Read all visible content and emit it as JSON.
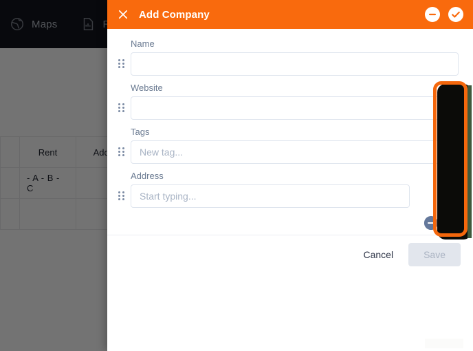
{
  "background": {
    "navbar": {
      "items": [
        {
          "label": "Maps",
          "icon": "globe-icon"
        },
        {
          "label": "Rep",
          "icon": "report-icon"
        }
      ]
    },
    "table": {
      "columns": [
        "",
        "Rent",
        "Address",
        ""
      ],
      "rows": [
        [
          "",
          "- A - B - C",
          "",
          ""
        ],
        [
          "",
          "",
          "",
          ""
        ]
      ]
    }
  },
  "dialog": {
    "title": "Add Company",
    "close_icon": "close-icon",
    "header_actions": [
      {
        "name": "collapse-all-button",
        "icon": "minus-circle-icon"
      },
      {
        "name": "confirm-button",
        "icon": "check-circle-icon"
      }
    ],
    "fields": [
      {
        "label": "Name",
        "placeholder": "",
        "value": "",
        "handle": "drag-handle-icon",
        "action": "none"
      },
      {
        "label": "Website",
        "placeholder": "",
        "value": "",
        "handle": "drag-handle-icon",
        "action": "remove"
      },
      {
        "label": "Tags",
        "placeholder": "New tag...",
        "value": "",
        "handle": "drag-handle-icon",
        "action": "remove"
      },
      {
        "label": "Address",
        "placeholder": "Start typing...",
        "value": "",
        "handle": "drag-handle-icon",
        "action": "remove-and-add"
      }
    ],
    "footer": {
      "cancel_label": "Cancel",
      "save_label": "Save",
      "save_disabled": true
    }
  },
  "annotation": {
    "type": "highlight-rectangle",
    "color": "#f4670c"
  },
  "colors": {
    "accent_orange": "#f96a0d",
    "annotation_orange": "#f4670c",
    "navbar_dark": "#13161d",
    "circle_button": "#64789b",
    "label_text": "#6b7b92",
    "save_disabled_bg": "#e2e6ed",
    "input_border": "#dfe5ee"
  }
}
